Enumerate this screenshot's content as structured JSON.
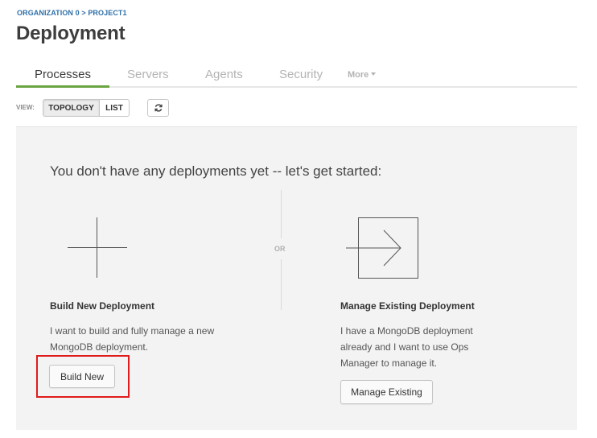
{
  "breadcrumb": {
    "org": "ORGANIZATION 0",
    "separator": ">",
    "project": "PROJECT1"
  },
  "page_title": "Deployment",
  "tabs": [
    {
      "label": "Processes",
      "active": true
    },
    {
      "label": "Servers",
      "active": false
    },
    {
      "label": "Agents",
      "active": false
    },
    {
      "label": "Security",
      "active": false
    }
  ],
  "more_tab": {
    "label": "More"
  },
  "view": {
    "label": "VIEW:",
    "options": [
      "TOPOLOGY",
      "LIST"
    ],
    "selected": "TOPOLOGY",
    "refresh_icon": "refresh-icon"
  },
  "empty_state": {
    "headline": "You don't have any deployments yet -- let's get started:",
    "or_label": "OR",
    "build": {
      "title": "Build New Deployment",
      "desc_line1": "I want to build and fully manage a new",
      "desc_line2": "MongoDB deployment.",
      "button": "Build New",
      "icon": "plus-icon"
    },
    "manage": {
      "title": "Manage Existing Deployment",
      "desc_line1": "I have a MongoDB deployment",
      "desc_line2": "already and I want to use Ops",
      "desc_line3": "Manager to manage it.",
      "button": "Manage Existing",
      "icon": "import-arrow-icon"
    }
  },
  "colors": {
    "accent_green": "#6ba442",
    "link_blue": "#2f6fa8",
    "highlight_red": "#e01b1b",
    "panel_bg": "#f2f3f2"
  }
}
